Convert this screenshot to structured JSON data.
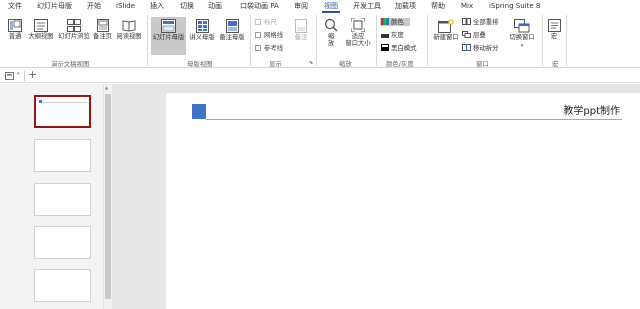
{
  "tabs": [
    "文件",
    "幻灯片母版",
    "开始",
    "iSlide",
    "插入",
    "切换",
    "动画",
    "口袋动画 PA",
    "审阅",
    "视图",
    "开发工具",
    "加载项",
    "帮助",
    "Mix",
    "iSpring Suite 8"
  ],
  "active_tab": "视图",
  "accent_color": "#2b579a",
  "ribbon": {
    "presentation_views": {
      "label": "演示文稿视图",
      "buttons": [
        "普通",
        "大纲视图",
        "幻灯片浏览",
        "备注页",
        "阅读视图"
      ]
    },
    "master_views": {
      "label": "母版视图",
      "buttons": [
        "幻灯片母版",
        "讲义母版",
        "备注母版"
      ],
      "selected": "幻灯片母版"
    },
    "show": {
      "label": "显示",
      "checkboxes": [
        "标尺",
        "网格线",
        "参考线"
      ],
      "notes_button": "备注"
    },
    "zoom": {
      "label": "缩放",
      "zoom_button": "缩\n放",
      "fit_button": "适应\n窗口大小"
    },
    "color": {
      "label": "颜色/灰度",
      "options": [
        "颜色",
        "灰度",
        "黑白模式"
      ]
    },
    "window": {
      "label": "窗口",
      "new_window": "新建窗口",
      "small": [
        "全部重排",
        "层叠",
        "移动拆分"
      ],
      "switch": "切换窗口"
    },
    "macros": {
      "label": "宏",
      "button": "宏"
    }
  },
  "toolbar": {
    "add": "+"
  },
  "slide": {
    "title": "教学ppt制作",
    "square_color": "#4472c4",
    "line_color": "#8eaad2"
  },
  "thumbnails": [
    {
      "selected": true
    },
    {
      "selected": false
    },
    {
      "selected": false
    },
    {
      "selected": false
    },
    {
      "selected": false
    }
  ]
}
